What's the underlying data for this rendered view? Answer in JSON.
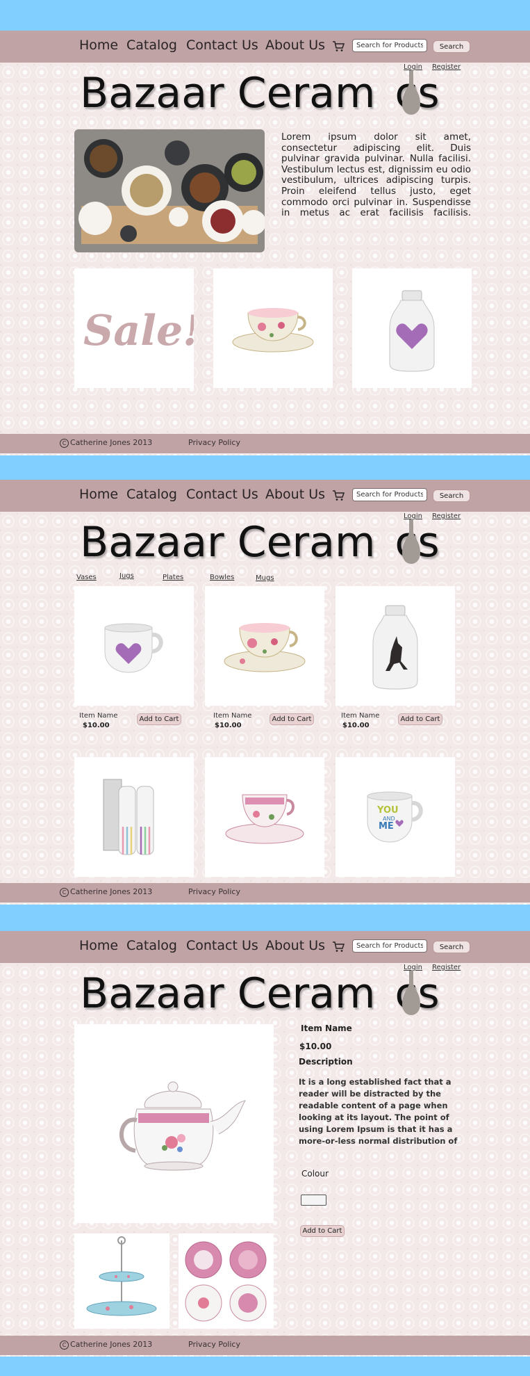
{
  "nav": {
    "links": [
      "Home",
      "Catalog",
      "Contact Us",
      "About Us"
    ],
    "search_placeholder": "Search for Products",
    "search_button": "Search",
    "login": "Login",
    "register": "Register",
    "cart_icon": "cart-icon"
  },
  "brand": {
    "logo_text": "Bazaar Ceram",
    "logo_text_end": "cs"
  },
  "footer": {
    "copyright": "Catherine Jones 2013",
    "privacy": "Privacy Policy"
  },
  "home": {
    "intro": "Lorem ipsum dolor sit amet, consectetur adipiscing elit. Duis pulvinar gravida pulvinar. Nulla facilisi. Vestibulum lectus est, dignissim eu odio vestibulum, ultrices adipiscing turpis. Proin eleifend tellus justo, eget commodo orci pulvinar in. Suspendisse in metus ac erat facilisis facilisis. Nullam facilisis lacus necfacilisis lacus nec",
    "sale_text": "Sale!"
  },
  "catalog": {
    "categories": [
      "Vases",
      "Jugs",
      "Plates",
      "Bowles",
      "Mugs"
    ],
    "items": [
      {
        "name": "Item Name",
        "price": "$10.00",
        "button": "Add to Cart"
      },
      {
        "name": "Item Name",
        "price": "$10.00",
        "button": "Add to Cart"
      },
      {
        "name": "Item Name",
        "price": "$10.00",
        "button": "Add to Cart"
      }
    ],
    "mug_text_you": "YOU",
    "mug_text_and": "AND",
    "mug_text_me": "ME"
  },
  "detail": {
    "item_name": "Item Name",
    "price": "$10.00",
    "description_label": "Description",
    "description": "It is a long established fact that a reader will be distracted by the readable content of a page when looking at its layout. The point of using Lorem Ipsum is that it has a more-or-less normal distribution of letters, as opposed to using",
    "colour_label": "Colour",
    "add_to_cart": "Add to Cart"
  },
  "colors": {
    "sky": "#80cfff",
    "bar": "#bfa3a5",
    "background": "#f3e9e9",
    "accent_pink": "#a46bb6"
  }
}
